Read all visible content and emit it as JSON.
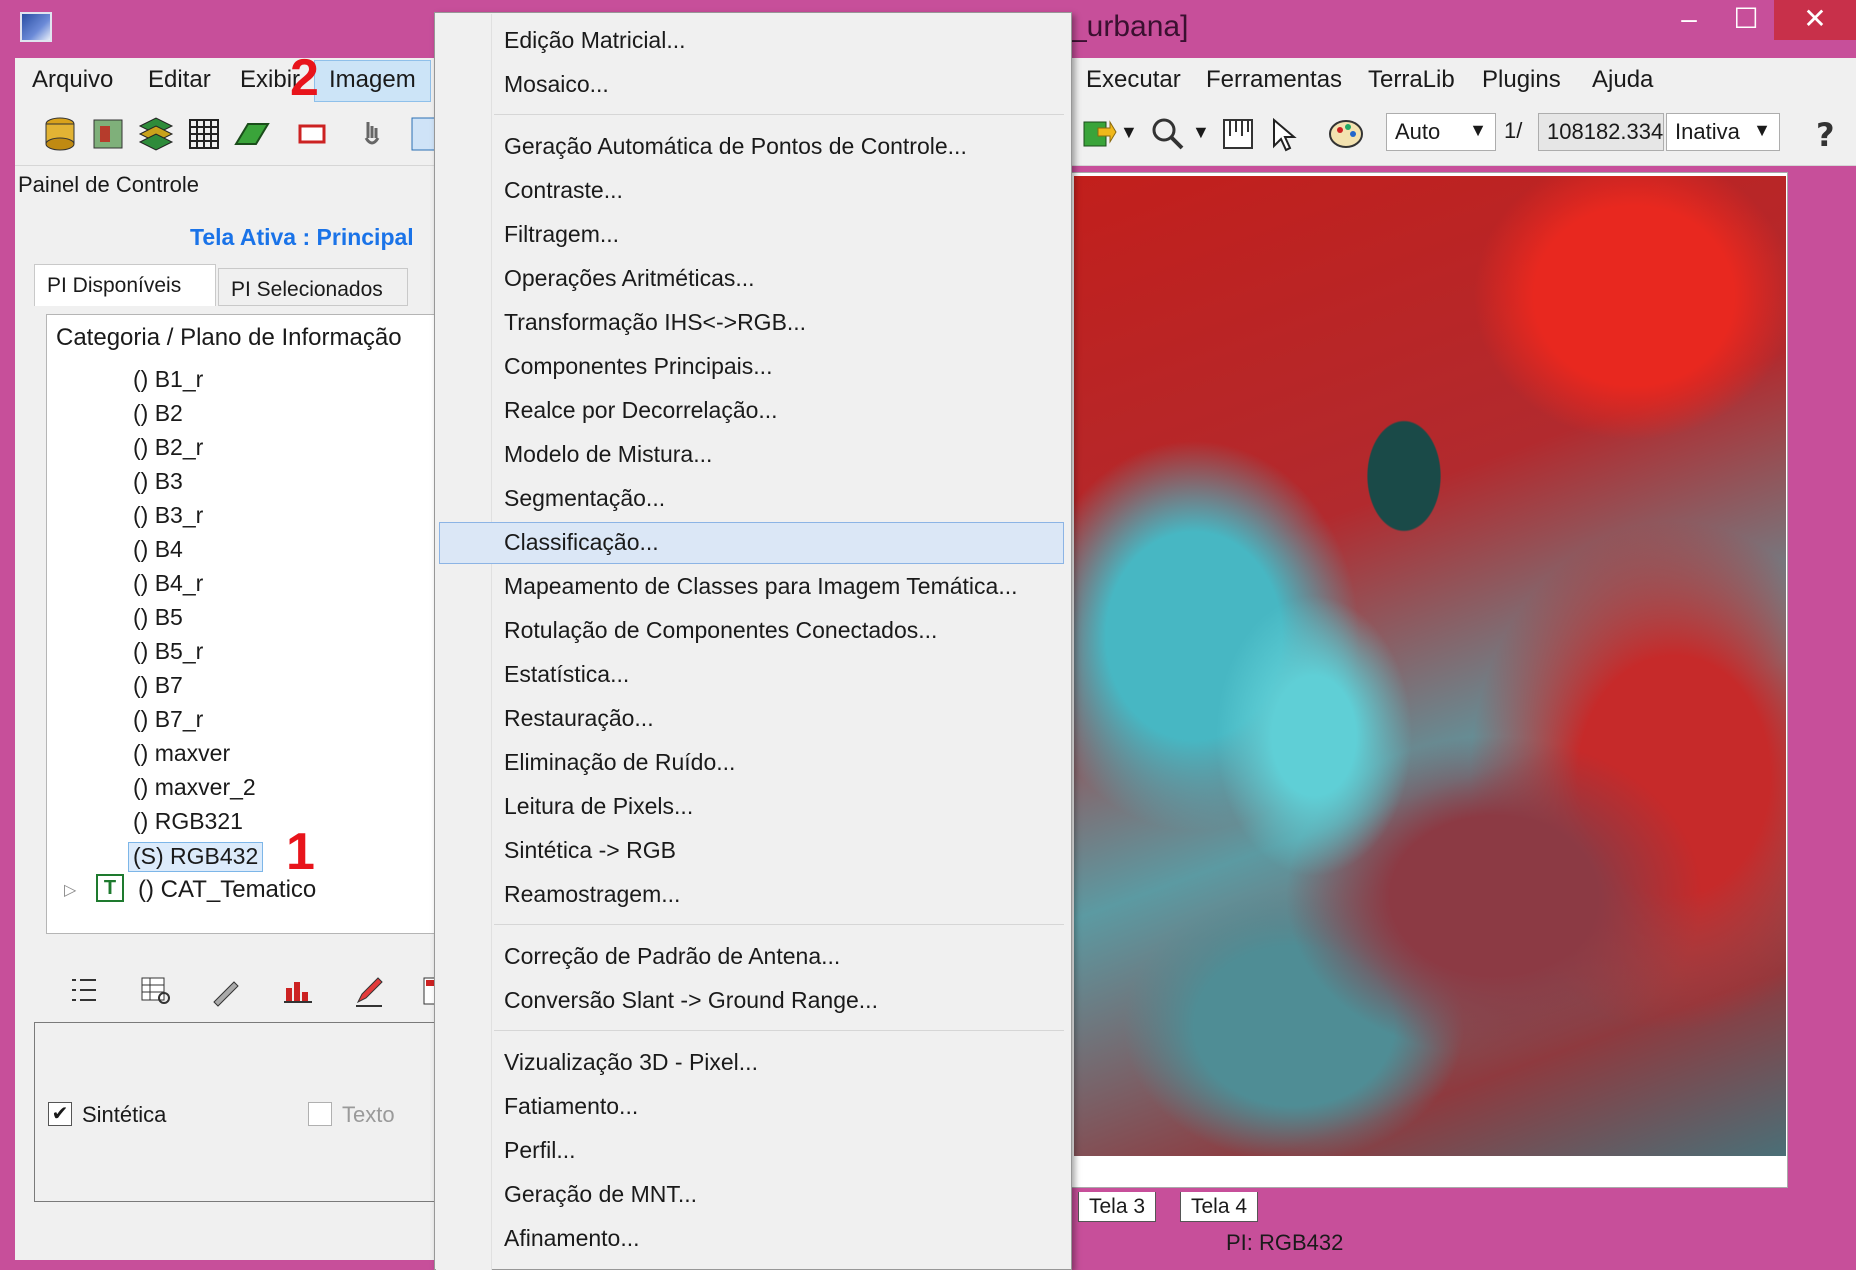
{
  "window": {
    "title": "_urbana]",
    "min": "–",
    "max": "☐",
    "close": "✕"
  },
  "menubar": {
    "items": [
      "Arquivo",
      "Editar",
      "Exibir",
      "Imagem",
      "Executar",
      "Ferramentas",
      "TerraLib",
      "Plugins",
      "Ajuda"
    ]
  },
  "toolbar": {
    "zoom_mode": "Auto",
    "scale_prefix": "1/",
    "scale_value": "108182.334",
    "state": "Inativa"
  },
  "panel": {
    "title": "Painel de Controle",
    "active_screen": "Tela Ativa : Principal",
    "tabs": [
      "PI Disponíveis",
      "PI Selecionados"
    ],
    "tree_header": "Categoria / Plano de Informação",
    "layers": [
      "() B1_r",
      "() B2",
      "() B2_r",
      "() B3",
      "() B3_r",
      "() B4",
      "() B4_r",
      "() B5",
      "() B5_r",
      "() B7",
      "() B7_r",
      "() maxver",
      "() maxver_2",
      "() RGB321",
      "(S) RGB432"
    ],
    "category": "() CAT_Tematico",
    "category_icon": "T",
    "checks": {
      "sintetica": "Sintética",
      "sintetica_checked": true,
      "texto": "Texto",
      "texto_checked": false
    }
  },
  "annotations": {
    "one": "1",
    "two": "2"
  },
  "image_menu": {
    "items": [
      "Edição Matricial...",
      "Mosaico...",
      "Geração Automática de Pontos de Controle...",
      "Contraste...",
      "Filtragem...",
      "Operações Aritméticas...",
      "Transformação IHS<->RGB...",
      "Componentes Principais...",
      "Realce por Decorrelação...",
      "Modelo de Mistura...",
      "Segmentação...",
      "Classificação...",
      "Mapeamento de Classes para Imagem Temática...",
      "Rotulação de Componentes Conectados...",
      "Estatística...",
      "Restauração...",
      "Eliminação de Ruído...",
      "Leitura de Pixels...",
      "Sintética -> RGB",
      "Reamostragem...",
      "Correção de Padrão de Antena...",
      "Conversão Slant -> Ground Range...",
      "Vizualização 3D - Pixel...",
      "Fatiamento...",
      "Perfil...",
      "Geração de MNT...",
      "Afinamento..."
    ],
    "highlighted": "Classificação..."
  },
  "view": {
    "tabs": [
      "Tela 3",
      "Tela 4"
    ],
    "status": "PI: RGB432"
  }
}
